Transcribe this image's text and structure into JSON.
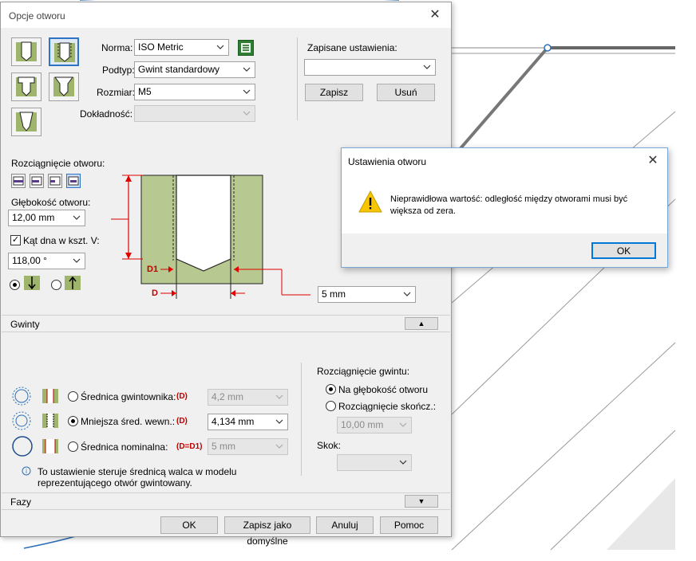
{
  "main_dialog": {
    "title": "Opcje otworu",
    "labels": {
      "norma": "Norma:",
      "podtyp": "Podtyp:",
      "rozmiar": "Rozmiar:",
      "dokladnosc": "Dokładność:",
      "zapisane": "Zapisane ustawienia:",
      "rozciagniecie_otworu": "Rozciągnięcie otworu:",
      "glebokosc": "Głębokość otworu:",
      "kat_dna": "Kąt dna w kszt. V:"
    },
    "values": {
      "norma": "ISO Metric",
      "podtyp": "Gwint standardowy",
      "rozmiar": "M5",
      "dokladnosc": "",
      "zapisane": "",
      "glebokosc": "12,00 mm",
      "kat_dna": "118,00 °",
      "diameter_select": "5 mm"
    },
    "buttons": {
      "zapisz": "Zapisz",
      "usun": "Usuń"
    },
    "diagram": {
      "d1": "D1",
      "d": "D"
    },
    "gwinty": {
      "section": "Gwinty",
      "options": [
        {
          "label": "Średnica gwintownika:",
          "tag": "(D)",
          "value": "4,2 mm"
        },
        {
          "label": "Mniejsza śred. wewn.:",
          "tag": "(D)",
          "value": "4,134 mm"
        },
        {
          "label": "Średnica nominalna:",
          "tag": "(D=D1)",
          "value": "5 mm"
        }
      ],
      "info": "To ustawienie steruje średnicą walca w modelu reprezentującego otwór gwintowany.",
      "rozciagniecie_gwintu": "Rozciągnięcie gwintu:",
      "na_glebokosc": "Na głębokość otworu",
      "rozciagniecie_skoncz": "Rozciągnięcie skończ.:",
      "skoncz_value": "10,00 mm",
      "skok": "Skok:",
      "skok_value": ""
    },
    "fazy": "Fazy",
    "footer": {
      "ok": "OK",
      "domyslne": "Zapisz jako domyślne",
      "anuluj": "Anuluj",
      "pomoc": "Pomoc"
    }
  },
  "alert": {
    "title": "Ustawienia otworu",
    "message_line1": "Nieprawidłowa wartość: odległość między otworami musi być",
    "message_line2": "większa od zera.",
    "ok": "OK"
  },
  "colors": {
    "material": "#b7c890",
    "accent": "#0078d7",
    "dimension_red": "#e00000",
    "warning": "#f7c600"
  }
}
